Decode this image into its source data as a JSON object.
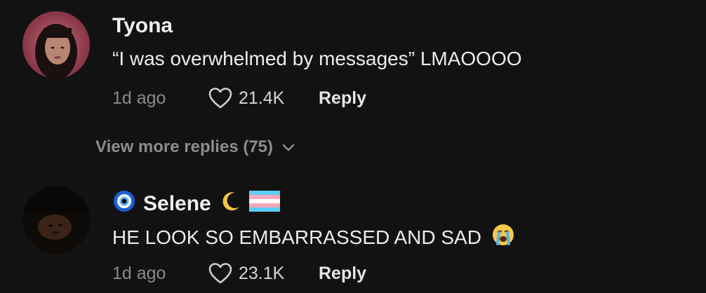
{
  "comments": [
    {
      "username": "Tyona",
      "text": "“I was overwhelmed by messages” LMAOOOO",
      "time": "1d ago",
      "likes": "21.4K",
      "reply_label": "Reply",
      "view_more": "View more replies (75)",
      "avatar_desc": "profile photo"
    },
    {
      "username": "Selene",
      "text": "HE LOOK SO EMBARRASSED AND SAD",
      "time": "1d ago",
      "likes": "23.1K",
      "reply_label": "Reply",
      "avatar_desc": "profile photo"
    }
  ],
  "icons": {
    "heart": "heart-outline-icon",
    "chevron": "chevron-down-icon",
    "nazar": "nazar-amulet-icon",
    "moon": "crescent-moon-icon",
    "flag": "transgender-flag-icon",
    "crying": "loudly-crying-face-icon"
  },
  "colors": {
    "background": "#121212",
    "primary_text": "#ffffff",
    "secondary_text": "#8a8a8a"
  }
}
